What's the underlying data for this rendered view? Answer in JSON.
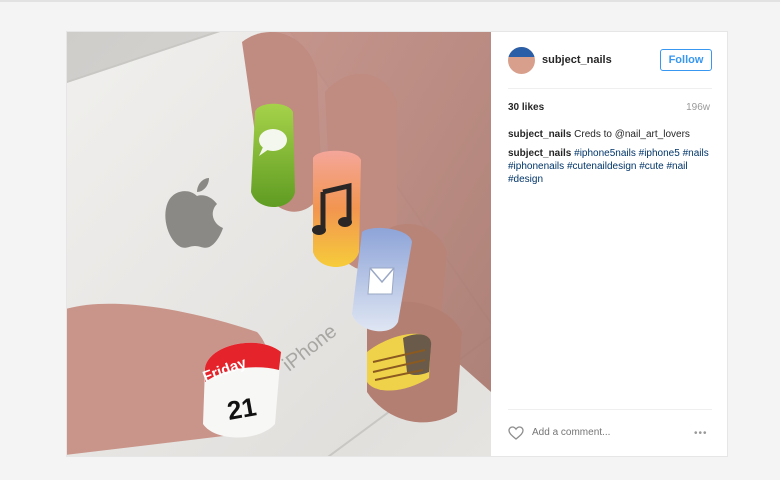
{
  "post": {
    "username": "subject_nails",
    "follow_label": "Follow",
    "likes": "30 likes",
    "age": "196w",
    "caption": {
      "user": "subject_nails",
      "text": "Creds to @nail_art_lovers"
    },
    "hashtags_comment": {
      "user": "subject_nails",
      "tags": [
        "#iphone5nails",
        "#iphone5",
        "#nails",
        "#iphonenails",
        "#cutenaildesign",
        "#cute",
        "#nail",
        "#design"
      ]
    },
    "comment_placeholder": "Add a comment...",
    "more_options": "•••",
    "photo": {
      "phone_brand_text": "iPhone",
      "calendar_day_label": "Friday",
      "calendar_day_number": "21"
    }
  },
  "colors": {
    "link": "#003569",
    "accent": "#3897f0",
    "muted": "#999999"
  },
  "icons": [
    "heart-icon",
    "apple-logo-icon",
    "messages-icon",
    "music-icon",
    "mail-icon",
    "notes-icon",
    "calendar-icon"
  ]
}
